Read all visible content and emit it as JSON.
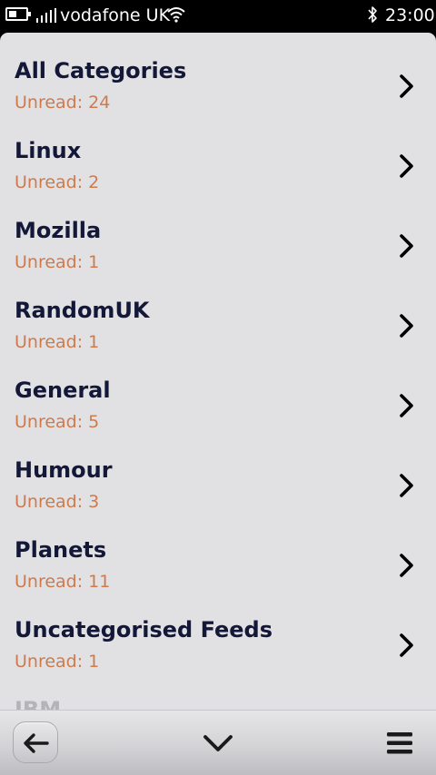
{
  "status_bar": {
    "carrier": "vodafone UK",
    "time": "23:00",
    "icons": [
      "battery-icon",
      "signal-icon",
      "wifi-icon",
      "bluetooth-icon"
    ]
  },
  "categories": [
    {
      "name": "All Categories",
      "unread": "Unread: 24"
    },
    {
      "name": "Linux",
      "unread": "Unread: 2"
    },
    {
      "name": "Mozilla",
      "unread": "Unread: 1"
    },
    {
      "name": "RandomUK",
      "unread": "Unread: 1"
    },
    {
      "name": "General",
      "unread": "Unread: 5"
    },
    {
      "name": "Humour",
      "unread": "Unread: 3"
    },
    {
      "name": "Planets",
      "unread": "Unread: 11"
    },
    {
      "name": "Uncategorised Feeds",
      "unread": "Unread: 1"
    },
    {
      "name": "IBM"
    }
  ],
  "toolbar": {
    "icons": [
      "back-arrow-icon",
      "chevron-down-icon",
      "menu-icon"
    ]
  },
  "colors": {
    "background": "#e1e1e4",
    "title": "#141838",
    "unread": "#cf7a4d",
    "status_bar": "#000000"
  }
}
